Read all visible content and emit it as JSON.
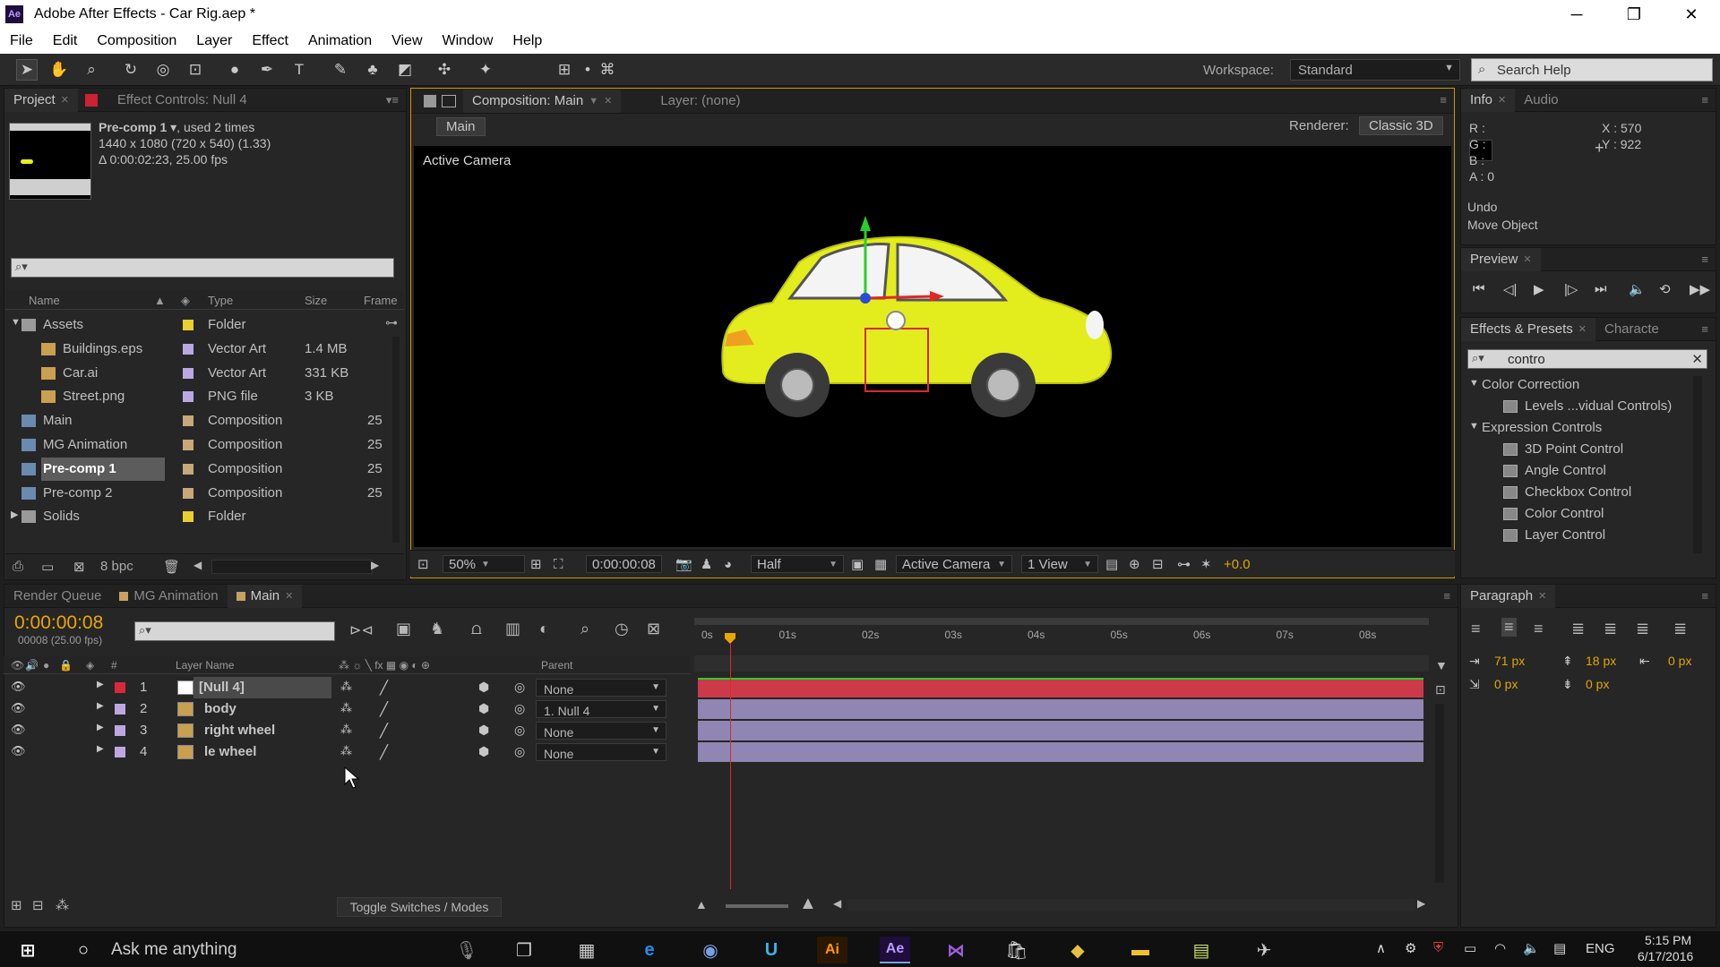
{
  "window": {
    "title": "Adobe After Effects - Car Rig.aep *",
    "app_logo": "Ae"
  },
  "menu": [
    "File",
    "Edit",
    "Composition",
    "Layer",
    "Effect",
    "Animation",
    "View",
    "Window",
    "Help"
  ],
  "toolbar": {
    "workspace_label": "Workspace:",
    "workspace_value": "Standard",
    "search_placeholder": "Search Help"
  },
  "project_panel": {
    "tab_project": "Project",
    "tab_effect_controls": "Effect Controls: Null 4",
    "item_name": "Pre-comp 1",
    "item_used": ", used 2 times",
    "item_dims": "1440 x 1080  (720 x 540) (1.33)",
    "item_duration": "Δ 0:00:02:23, 25.00 fps",
    "columns": {
      "name": "Name",
      "type": "Type",
      "size": "Size",
      "frame": "Frame"
    },
    "items": [
      {
        "name": "Assets",
        "type": "Folder",
        "size": "",
        "frame": ""
      },
      {
        "name": "Buildings.eps",
        "type": "Vector Art",
        "size": "1.4 MB",
        "frame": ""
      },
      {
        "name": "Car.ai",
        "type": "Vector Art",
        "size": "331 KB",
        "frame": ""
      },
      {
        "name": "Street.png",
        "type": "PNG file",
        "size": "3 KB",
        "frame": ""
      },
      {
        "name": "Main",
        "type": "Composition",
        "size": "",
        "frame": "25"
      },
      {
        "name": "MG Animation",
        "type": "Composition",
        "size": "",
        "frame": "25"
      },
      {
        "name": "Pre-comp 1",
        "type": "Composition",
        "size": "",
        "frame": "25"
      },
      {
        "name": "Pre-comp 2",
        "type": "Composition",
        "size": "",
        "frame": "25"
      },
      {
        "name": "Solids",
        "type": "Folder",
        "size": "",
        "frame": ""
      }
    ],
    "bpc": "8 bpc"
  },
  "viewer": {
    "tab_composition": "Composition: Main",
    "tab_layer": "Layer: (none)",
    "breadcrumb": "Main",
    "renderer_label": "Renderer:",
    "renderer_value": "Classic 3D",
    "camera_label": "Active Camera",
    "zoom": "50%",
    "timecode": "0:00:00:08",
    "resolution": "Half",
    "camera_view": "Active Camera",
    "views": "1 View",
    "exposure": "+0.0"
  },
  "info_panel": {
    "tab_info": "Info",
    "tab_audio": "Audio",
    "r": "R :",
    "g": "G :",
    "b": "B :",
    "a": "A : 0",
    "x": "X : 570",
    "y": "Y : 922",
    "undo_label": "Undo",
    "undo_action": "Move Object"
  },
  "preview_panel": {
    "tab": "Preview"
  },
  "effects_panel": {
    "tab_effects": "Effects & Presets",
    "tab_character": "Characte",
    "search_value": "contro",
    "groups": [
      {
        "name": "Color Correction",
        "items": [
          "Levels ...vidual Controls)"
        ]
      },
      {
        "name": "Expression Controls",
        "items": [
          "3D Point Control",
          "Angle Control",
          "Checkbox Control",
          "Color Control",
          "Layer Control"
        ]
      }
    ]
  },
  "timeline": {
    "tabs": [
      "Render Queue",
      "MG Animation",
      "Main"
    ],
    "timecode": "0:00:00:08",
    "frame_info": "00008 (25.00 fps)",
    "col_layer_name": "Layer Name",
    "col_hash": "#",
    "col_parent": "Parent",
    "ruler": [
      "0s",
      "01s",
      "02s",
      "03s",
      "04s",
      "05s",
      "06s",
      "07s",
      "08s"
    ],
    "playhead_seconds": 0.32,
    "layers": [
      {
        "num": "1",
        "name": "[Null 4]",
        "parent": "None",
        "label_color": "#d8283a"
      },
      {
        "num": "2",
        "name": "body",
        "parent": "1. Null 4",
        "label_color": "#b9a9e0"
      },
      {
        "num": "3",
        "name": "right wheel",
        "parent": "None",
        "label_color": "#b9a9e0"
      },
      {
        "num": "4",
        "name": "le wheel",
        "parent": "None",
        "label_color": "#b9a9e0"
      }
    ],
    "toggle_label": "Toggle Switches / Modes"
  },
  "paragraph_panel": {
    "tab": "Paragraph",
    "indent_left": "71 px",
    "space_before": "18 px",
    "indent_right": "0 px",
    "first_line": "0 px",
    "space_after": "0 px"
  },
  "taskbar": {
    "search_placeholder": "Ask me anything",
    "lang": "ENG",
    "time": "5:15 PM",
    "date": "6/17/2016"
  },
  "colors": {
    "accent_yellow": "#e9a800",
    "null_bar": "#cc3a4a",
    "layer_bar": "#8f86b4",
    "car_body": "#e8f01a"
  }
}
